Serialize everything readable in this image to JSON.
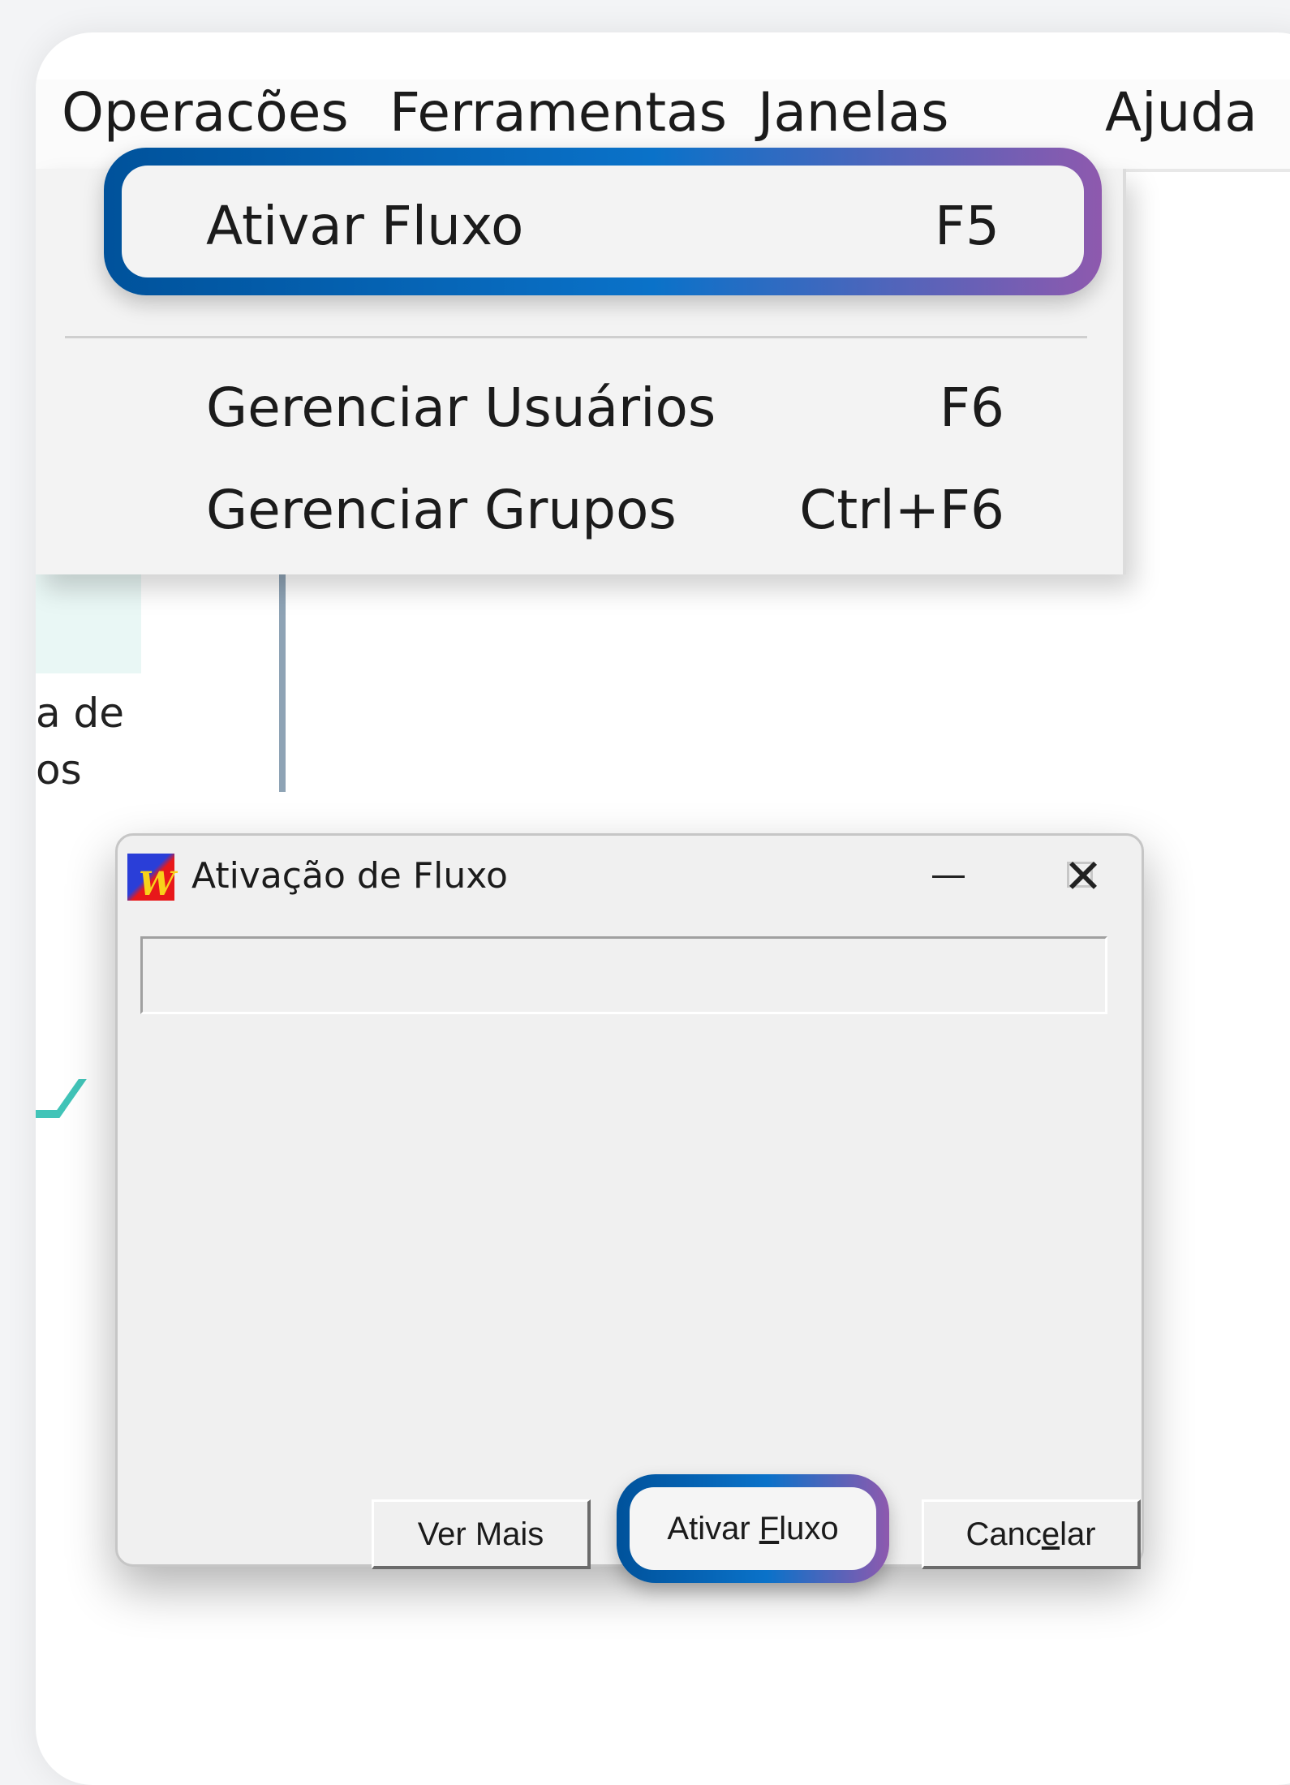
{
  "menubar": {
    "items": [
      "Operacões",
      "Ferramentas",
      "Janelas",
      "Ajuda"
    ]
  },
  "dropdown": {
    "items": [
      {
        "label": "Ativar Fluxo",
        "shortcut": "F5"
      },
      {
        "label": "Gerenciar Usuários",
        "shortcut": "F6"
      },
      {
        "label": "Gerenciar Grupos",
        "shortcut": "Ctrl+F6"
      }
    ]
  },
  "background": {
    "text_line1": "a de",
    "text_line2": "os"
  },
  "dialog": {
    "title": "Ativação de Fluxo",
    "field_value": "",
    "buttons": {
      "ver_mais": "Ver Mais",
      "ativar_pre": "Ativar ",
      "ativar_u": "F",
      "ativar_post": "luxo",
      "cancelar_pre": "Canc",
      "cancelar_u": "e",
      "cancelar_post": "lar"
    }
  },
  "colors": {
    "highlight_start": "#00529b",
    "highlight_mid": "#0a72c9",
    "highlight_end": "#8e59ae"
  },
  "icons": {
    "app": "app-logo-icon",
    "minimize": "minimize-icon",
    "maximize": "maximize-icon",
    "close": "close-icon"
  }
}
